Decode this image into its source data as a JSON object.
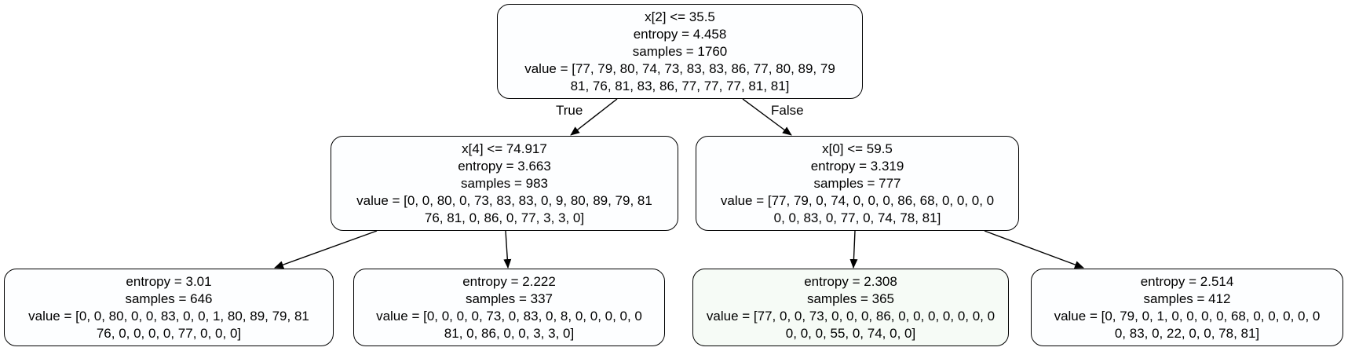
{
  "nodes": {
    "root": {
      "split": "x[2] <= 35.5",
      "entropy": "entropy = 4.458",
      "samples": "samples = 1760",
      "value1": "value = [77, 79, 80, 74, 73, 83, 83, 86, 77, 80, 89, 79",
      "value2": "81, 76, 81, 83, 86, 77, 77, 77, 81, 81]"
    },
    "left": {
      "split": "x[4] <= 74.917",
      "entropy": "entropy = 3.663",
      "samples": "samples = 983",
      "value1": "value = [0, 0, 80, 0, 73, 83, 83, 0, 9, 80, 89, 79, 81",
      "value2": "76, 81, 0, 86, 0, 77, 3, 3, 0]"
    },
    "right": {
      "split": "x[0] <= 59.5",
      "entropy": "entropy = 3.319",
      "samples": "samples = 777",
      "value1": "value = [77, 79, 0, 74, 0, 0, 0, 86, 68, 0, 0, 0, 0",
      "value2": "0, 0, 83, 0, 77, 0, 74, 78, 81]"
    },
    "ll": {
      "entropy": "entropy = 3.01",
      "samples": "samples = 646",
      "value1": "value = [0, 0, 80, 0, 0, 83, 0, 0, 1, 80, 89, 79, 81",
      "value2": "76, 0, 0, 0, 0, 77, 0, 0, 0]"
    },
    "lr": {
      "entropy": "entropy = 2.222",
      "samples": "samples = 337",
      "value1": "value = [0, 0, 0, 0, 73, 0, 83, 0, 8, 0, 0, 0, 0, 0",
      "value2": "81, 0, 86, 0, 0, 3, 3, 0]"
    },
    "rl": {
      "entropy": "entropy = 2.308",
      "samples": "samples = 365",
      "value1": "value = [77, 0, 0, 73, 0, 0, 0, 86, 0, 0, 0, 0, 0, 0, 0",
      "value2": "0, 0, 0, 55, 0, 74, 0, 0]"
    },
    "rr": {
      "entropy": "entropy = 2.514",
      "samples": "samples = 412",
      "value1": "value = [0, 79, 0, 1, 0, 0, 0, 0, 68, 0, 0, 0, 0, 0",
      "value2": "0, 83, 0, 22, 0, 0, 78, 81]"
    }
  },
  "edge_labels": {
    "true": "True",
    "false": "False"
  }
}
